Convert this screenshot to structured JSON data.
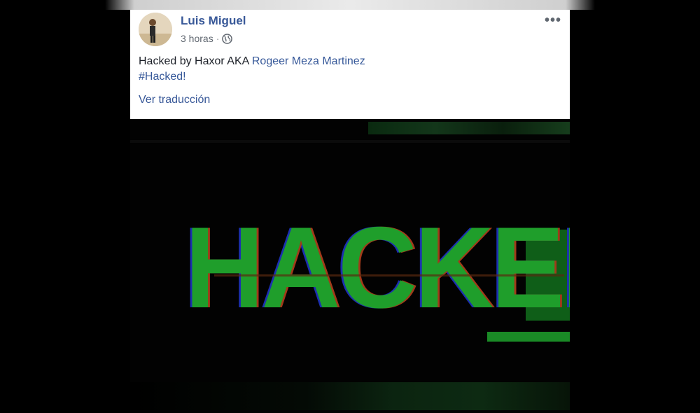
{
  "post": {
    "author": "Luis Miguel",
    "time": "3 horas",
    "separator": "·",
    "body_prefix": "Hacked by Haxor AKA ",
    "mention": "Rogeer Meza Martinez",
    "hashtag": "#Hacked!",
    "see_translation": "Ver traducción",
    "more_label": "•••"
  },
  "image": {
    "text": "HACKED",
    "colors": {
      "green": "#1f9e2b",
      "background": "#020202"
    }
  }
}
